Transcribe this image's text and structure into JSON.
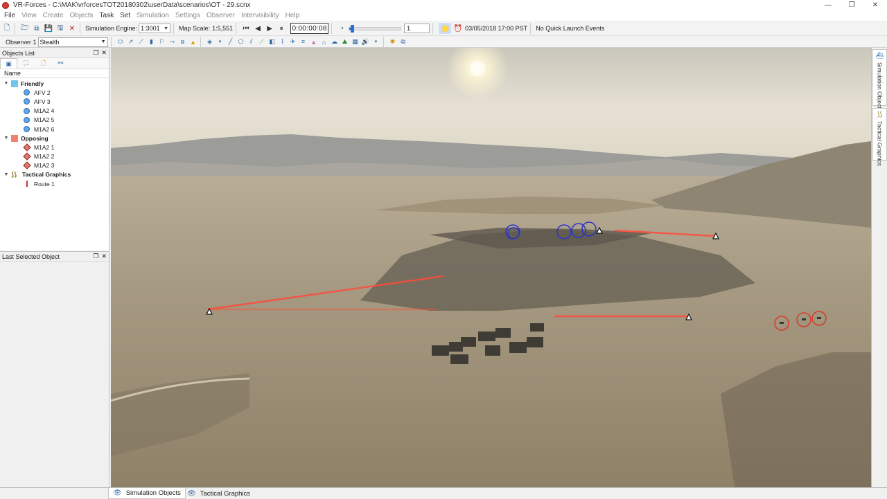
{
  "window": {
    "title": "VR-Forces - C:\\MAK\\vrforcesTOT20180302\\userData\\scenarios\\OT - 29.scnx",
    "minimize": "—",
    "maximize": "❐",
    "close": "✕"
  },
  "menu": [
    {
      "label": "File",
      "enabled": true
    },
    {
      "label": "View",
      "enabled": false
    },
    {
      "label": "Create",
      "enabled": false
    },
    {
      "label": "Objects",
      "enabled": false
    },
    {
      "label": "Task",
      "enabled": true
    },
    {
      "label": "Set",
      "enabled": true
    },
    {
      "label": "Simulation",
      "enabled": false
    },
    {
      "label": "Settings",
      "enabled": false
    },
    {
      "label": "Observer",
      "enabled": false
    },
    {
      "label": "Intervisibility",
      "enabled": false
    },
    {
      "label": "Help",
      "enabled": false
    }
  ],
  "toolbar": {
    "sim_engine_label": "Simulation Engine:",
    "sim_engine_value": "1:3001",
    "map_scale_label": "Map Scale:",
    "map_scale_value": "1:5,551",
    "sim_time": "0:00:00:08",
    "speed_fraction": 0.05,
    "speed_multiplier": "1",
    "datetime": "03/05/2018 17:00 PST",
    "quick_launch": "No Quick Launch Events"
  },
  "toolbar2": {
    "observer_label": "Observer 1",
    "observer_mode": "Stealth"
  },
  "objects_panel": {
    "title": "Objects List",
    "column_name": "Name",
    "groups": [
      {
        "label": "Friendly",
        "color": "#6ec6f0",
        "items": [
          "AFV 2",
          "AFV 3",
          "M1A2 4",
          "M1A2 5",
          "M1A2 6"
        ]
      },
      {
        "label": "Opposing",
        "color": "#f08070",
        "items": [
          "M1A2 1",
          "M1A2 2",
          "M1A2 3"
        ]
      },
      {
        "label": "Tactical Graphics",
        "color": "#c4352b",
        "items": [
          "Route 1"
        ]
      }
    ]
  },
  "last_selected_panel": {
    "title": "Last Selected Object"
  },
  "right_tabs": {
    "simulation_objects": "Simulation Objects",
    "tactical_graphics": "Tactical Graphics"
  },
  "bottom_tabs": {
    "simulation_objects": "Simulation Objects",
    "tactical_graphics": "Tactical Graphics"
  },
  "colors": {
    "friendly_marker": "#2a34c8",
    "opposing_marker": "#d63a2c",
    "route_line": "#ff4a3a"
  }
}
